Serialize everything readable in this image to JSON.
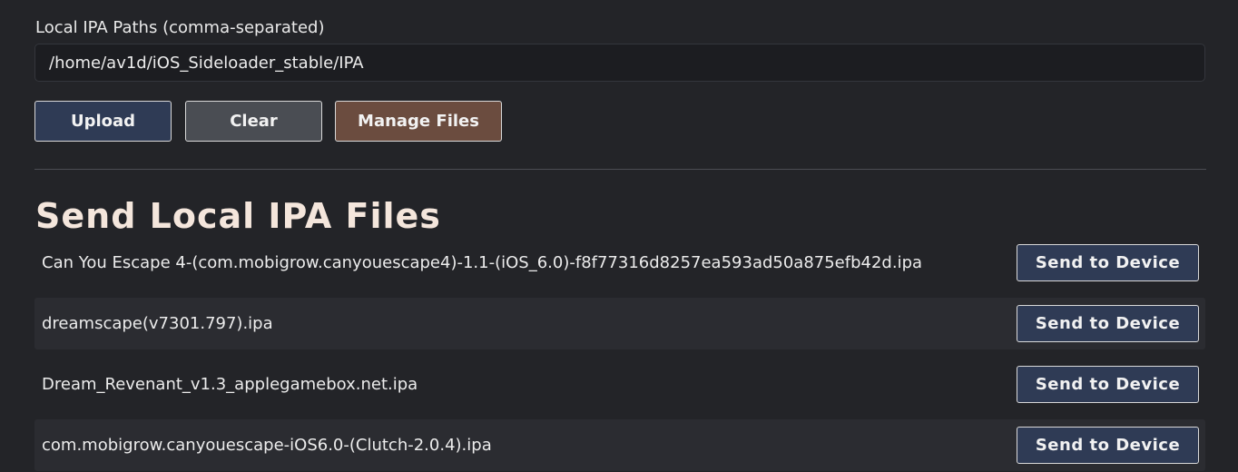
{
  "upload_form": {
    "paths_label": "Local IPA Paths (comma-separated)",
    "paths_value": "/home/av1d/iOS_Sideloader_stable/IPA",
    "upload_label": "Upload",
    "clear_label": "Clear",
    "manage_label": "Manage Files"
  },
  "send_section": {
    "title": "Send Local IPA Files",
    "files": [
      {
        "name": "Can You Escape 4-(com.mobigrow.canyouescape4)-1.1-(iOS_6.0)-f8f77316d8257ea593ad50a875efb42d.ipa",
        "button": "Send to Device"
      },
      {
        "name": "dreamscape(v7301.797).ipa",
        "button": "Send to Device"
      },
      {
        "name": "Dream_Revenant_v1.3_applegamebox.net.ipa",
        "button": "Send to Device"
      },
      {
        "name": "com.mobigrow.canyouescape-iOS6.0-(Clutch-2.0.4).ipa",
        "button": "Send to Device"
      }
    ]
  }
}
